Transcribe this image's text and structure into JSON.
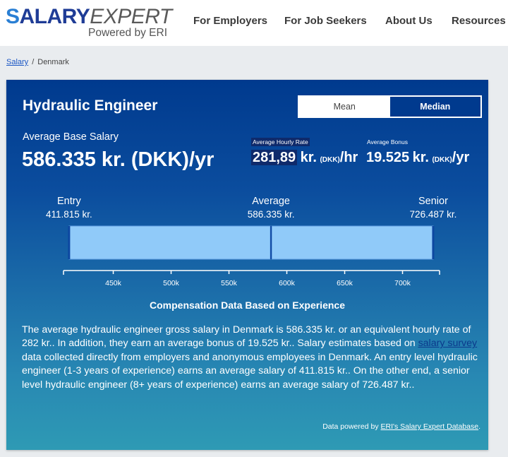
{
  "header": {
    "logo": {
      "s": "S",
      "salary": "ALARY",
      "expert": "EXPERT",
      "tagline": "Powered by ERI"
    },
    "nav": [
      {
        "label": "For Employers"
      },
      {
        "label": "For Job Seekers"
      },
      {
        "label": "About Us"
      },
      {
        "label": "Resources"
      }
    ]
  },
  "breadcrumb": {
    "link": "Salary",
    "separator": "/",
    "current": "Denmark"
  },
  "card": {
    "title": "Hydraulic Engineer",
    "toggle": {
      "mean": "Mean",
      "median": "Median",
      "selected": "Median"
    },
    "base": {
      "label": "Average Base Salary",
      "value": "586.335 kr. (DKK)/yr"
    },
    "hourly": {
      "label": "Average Hourly Rate",
      "number": "281,89",
      "currency": "kr.",
      "unit": "(DKK)",
      "period": "/hr"
    },
    "bonus": {
      "label": "Average Bonus",
      "number": "19.525",
      "currency": "kr.",
      "unit": "(DKK)",
      "period": "/yr"
    },
    "description": {
      "part1": "The average hydraulic engineer gross salary in Denmark is 586.335 kr. or an equivalent hourly rate of 282 kr.. In addition, they earn an average bonus of 19.525 kr.. Salary estimates based on ",
      "link": "salary survey",
      "part2": " data collected directly from employers and anonymous employees in Denmark. An entry level hydraulic engineer (1-3 years of experience) earns an average salary of 411.815 kr.. On the other end, a senior level hydraulic engineer (8+ years of experience) earns an average salary of 726.487 kr.."
    },
    "footer": {
      "prefix": "Data powered by ",
      "link": "ERI's Salary Expert Database",
      "suffix": "."
    }
  },
  "colors": {
    "bar_fill": "#90caf9",
    "bar_edge": "#0d47a1",
    "card_top": "#003a8e",
    "card_bottom": "#2e9ab4"
  },
  "chart_data": {
    "type": "bar",
    "title": "Compensation Data Based on Experience",
    "orientation": "horizontal-range",
    "levels": [
      {
        "name": "Entry",
        "label": "411.815 kr.",
        "value": 411815
      },
      {
        "name": "Average",
        "label": "586.335 kr.",
        "value": 586335
      },
      {
        "name": "Senior",
        "label": "726.487 kr.",
        "value": 726487
      }
    ],
    "xticks": [
      450000,
      500000,
      550000,
      600000,
      650000,
      700000
    ],
    "xtick_labels": [
      "450k",
      "500k",
      "550k",
      "600k",
      "650k",
      "700k"
    ],
    "xlim": [
      407000,
      732000
    ],
    "xlabel": "",
    "ylabel": ""
  }
}
